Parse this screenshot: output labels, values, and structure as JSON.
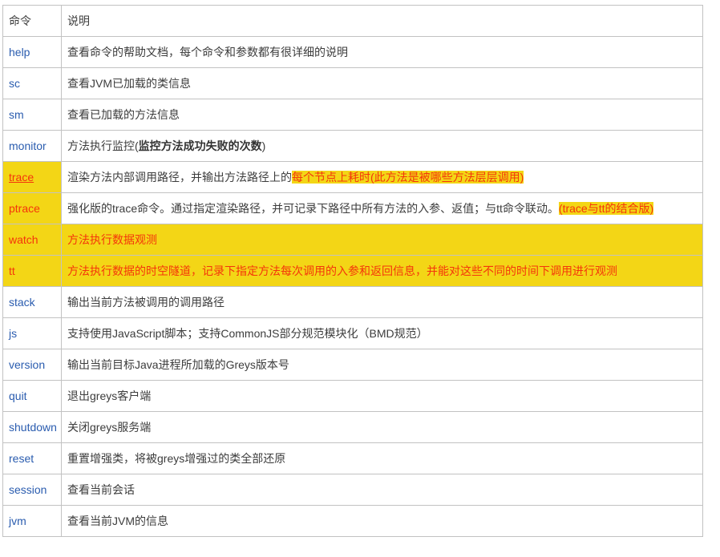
{
  "colors": {
    "highlight_yellow": "#f3d616",
    "highlight_red_text": "#f4350b",
    "link_blue": "#2a5caf",
    "border_gray": "#c2c2c2",
    "body_text": "#3c3c3c"
  },
  "table": {
    "header": {
      "cmd": "命令",
      "desc": "说明"
    },
    "rows": [
      {
        "cmd": "help",
        "cmd_style": "link",
        "cmd_highlight": false,
        "row_highlight": false,
        "desc": [
          {
            "text": "查看命令的帮助文档，每个命令和参数都有很详细的说明",
            "style": "normal"
          }
        ]
      },
      {
        "cmd": "sc",
        "cmd_style": "link",
        "cmd_highlight": false,
        "row_highlight": false,
        "desc": [
          {
            "text": "查看JVM已加载的类信息",
            "style": "normal"
          }
        ]
      },
      {
        "cmd": "sm",
        "cmd_style": "link",
        "cmd_highlight": false,
        "row_highlight": false,
        "desc": [
          {
            "text": "查看已加载的方法信息",
            "style": "normal"
          }
        ]
      },
      {
        "cmd": "monitor",
        "cmd_style": "link",
        "cmd_highlight": false,
        "row_highlight": false,
        "desc": [
          {
            "text": "方法执行监控(",
            "style": "normal"
          },
          {
            "text": "监控方法成功失败的次数",
            "style": "bold"
          },
          {
            "text": ")",
            "style": "normal"
          }
        ]
      },
      {
        "cmd": "trace",
        "cmd_style": "red-underline",
        "cmd_highlight": true,
        "row_highlight": false,
        "desc": [
          {
            "text": "渲染方法内部调用路径，并输出方法路径上的",
            "style": "normal"
          },
          {
            "text": "每个节点上耗时(此方法是被哪些方法层层调用)",
            "style": "mark"
          }
        ]
      },
      {
        "cmd": "ptrace",
        "cmd_style": "red",
        "cmd_highlight": true,
        "row_highlight": false,
        "desc": [
          {
            "text": "强化版的trace命令。通过指定渲染路径，并可记录下路径中所有方法的入参、返值；与tt命令联动。",
            "style": "normal"
          },
          {
            "text": "(trace与tt的结合版)",
            "style": "mark"
          }
        ]
      },
      {
        "cmd": "watch",
        "cmd_style": "red",
        "cmd_highlight": true,
        "row_highlight": true,
        "desc": [
          {
            "text": "方法执行数据观测",
            "style": "red"
          }
        ]
      },
      {
        "cmd": "tt",
        "cmd_style": "red",
        "cmd_highlight": true,
        "row_highlight": true,
        "desc": [
          {
            "text": "方法执行数据的时空隧道，记录下指定方法每次调用的入参和返回信息，并能对这些不同的时间下调用进行观测",
            "style": "red"
          }
        ]
      },
      {
        "cmd": "stack",
        "cmd_style": "link",
        "cmd_highlight": false,
        "row_highlight": false,
        "desc": [
          {
            "text": "输出当前方法被调用的调用路径",
            "style": "normal"
          }
        ]
      },
      {
        "cmd": "js",
        "cmd_style": "link",
        "cmd_highlight": false,
        "row_highlight": false,
        "desc": [
          {
            "text": "支持使用JavaScript脚本；支持CommonJS部分规范模块化（BMD规范）",
            "style": "normal"
          }
        ]
      },
      {
        "cmd": "version",
        "cmd_style": "link",
        "cmd_highlight": false,
        "row_highlight": false,
        "desc": [
          {
            "text": "输出当前目标Java进程所加载的Greys版本号",
            "style": "normal"
          }
        ]
      },
      {
        "cmd": "quit",
        "cmd_style": "link",
        "cmd_highlight": false,
        "row_highlight": false,
        "desc": [
          {
            "text": "退出greys客户端",
            "style": "normal"
          }
        ]
      },
      {
        "cmd": "shutdown",
        "cmd_style": "link",
        "cmd_highlight": false,
        "row_highlight": false,
        "desc": [
          {
            "text": "关闭greys服务端",
            "style": "normal"
          }
        ]
      },
      {
        "cmd": "reset",
        "cmd_style": "link",
        "cmd_highlight": false,
        "row_highlight": false,
        "desc": [
          {
            "text": "重置增强类，将被greys增强过的类全部还原",
            "style": "normal"
          }
        ]
      },
      {
        "cmd": "session",
        "cmd_style": "link",
        "cmd_highlight": false,
        "row_highlight": false,
        "desc": [
          {
            "text": "查看当前会话",
            "style": "normal"
          }
        ]
      },
      {
        "cmd": "jvm",
        "cmd_style": "link",
        "cmd_highlight": false,
        "row_highlight": false,
        "desc": [
          {
            "text": "查看当前JVM的信息",
            "style": "normal"
          }
        ]
      }
    ]
  }
}
